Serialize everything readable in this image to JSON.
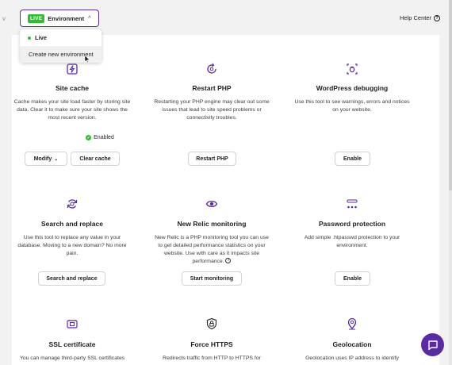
{
  "header": {
    "live_badge": "LIVE",
    "environment_label": "Environment",
    "environment_caret": "^",
    "help_label": "Help Center"
  },
  "env_dropdown": {
    "items": [
      {
        "label": "Live"
      },
      {
        "label": "Create new environment"
      }
    ]
  },
  "tools": [
    {
      "title": "Site cache",
      "description": "Cache makes your site load faster by storing site data. Clear it to make sure your site shows the most recent version.",
      "status": "Enabled",
      "buttons": [
        "Modify",
        "Clear cache"
      ],
      "icon": "cache-bolt-icon"
    },
    {
      "title": "Restart PHP",
      "description": "Restarting your PHP engine may clear out some issues that lead to site speed problems or connectivity troubles.",
      "buttons": [
        "Restart PHP"
      ],
      "icon": "restart-icon"
    },
    {
      "title": "WordPress debugging",
      "description": "Use this tool to see warnings, errors and notices on your website.",
      "buttons": [
        "Enable"
      ],
      "icon": "debug-bug-icon"
    },
    {
      "title": "Search and replace",
      "description": "Use this tool to replace any value in your database. Moving to a new domain? No more pain.",
      "buttons": [
        "Search and replace"
      ],
      "icon": "search-replace-icon"
    },
    {
      "title": "New Relic monitoring",
      "description": "New Relic is a PHP monitoring tool you can use to get detailed performance statistics on your website. Use with care as it impacts site performance.",
      "buttons": [
        "Start monitoring"
      ],
      "icon": "eye-icon"
    },
    {
      "title": "Password protection",
      "description": "Add simple .htpasswd protection to your environment.",
      "buttons": [
        "Enable"
      ],
      "icon": "password-icon"
    },
    {
      "title": "SSL certificate",
      "description": "You can manage third-party SSL certificates",
      "icon": "ssl-icon"
    },
    {
      "title": "Force HTTPS",
      "description": "Redirects traffic from HTTP to HTTPS for",
      "icon": "shield-lock-icon"
    },
    {
      "title": "Geolocation",
      "description": "Geolocation uses IP address to identify",
      "icon": "location-pin-icon"
    }
  ],
  "colors": {
    "accent": "#5b2aa6",
    "live": "#2fbe2f"
  }
}
